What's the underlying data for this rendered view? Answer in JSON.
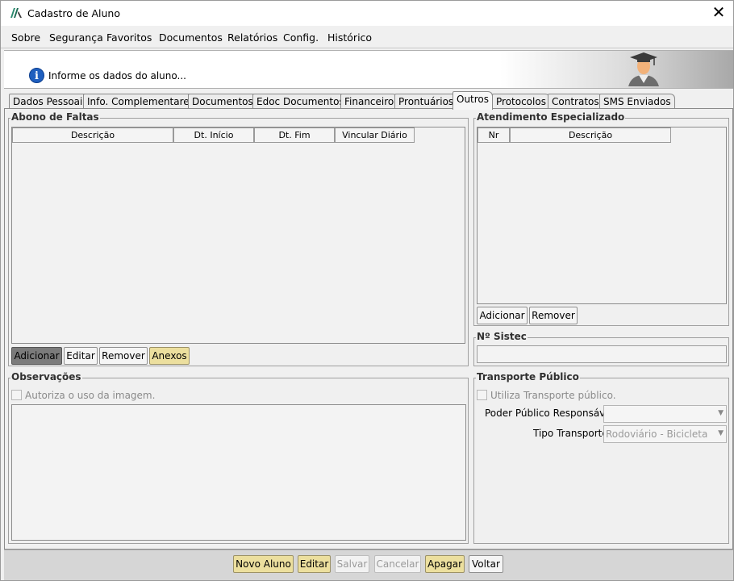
{
  "window": {
    "title": "Cadastro de Aluno",
    "close_glyph": "✕"
  },
  "menu": [
    "Sobre",
    "Segurança",
    "Favoritos",
    "Documentos",
    "Relatórios",
    "Config.",
    "Histórico"
  ],
  "banner": {
    "message": "Informe os dados do aluno...",
    "info_glyph": "i"
  },
  "tabs": [
    "Dados Pessoais",
    "Info. Complementares",
    "Documentos",
    "Edoc Documentos",
    "Financeiro",
    "Prontuários",
    "Outros",
    "Protocolos",
    "Contratos",
    "SMS Enviados"
  ],
  "active_tab": "Outros",
  "abono": {
    "title": "Abono de Faltas",
    "columns": [
      "Descrição",
      "Dt. Início",
      "Dt. Fim",
      "Vincular Diário"
    ],
    "buttons": {
      "add": "Adicionar",
      "edit": "Editar",
      "remove": "Remover",
      "attachments": "Anexos"
    }
  },
  "atendimento": {
    "title": "Atendimento Especializado",
    "columns": [
      "Nr",
      "Descrição"
    ],
    "buttons": {
      "add": "Adicionar",
      "remove": "Remover"
    }
  },
  "sistec": {
    "title": "Nº Sistec",
    "value": ""
  },
  "observacoes": {
    "title": "Observações",
    "checkbox_label": "Autoriza o uso da imagem.",
    "checked": false,
    "text": ""
  },
  "transporte": {
    "title": "Transporte Público",
    "checkbox_label": "Utiliza Transporte público.",
    "checked": false,
    "poder_label": "Poder Público Responsável:",
    "poder_value": "",
    "tipo_label": "Tipo Transporte:",
    "tipo_value": "Rodoviário - Bicicleta"
  },
  "footer": {
    "novo": "Novo Aluno",
    "editar": "Editar",
    "salvar": "Salvar",
    "cancelar": "Cancelar",
    "apagar": "Apagar",
    "voltar": "Voltar"
  },
  "colors": {
    "accent_yellow": "#ecdf9e",
    "info_blue": "#1f5fbf"
  },
  "icons": {
    "app": "app-logo-icon",
    "close": "close-icon",
    "info": "info-icon",
    "banner": "graduate-icon",
    "dropdown": "chevron-down-icon"
  }
}
